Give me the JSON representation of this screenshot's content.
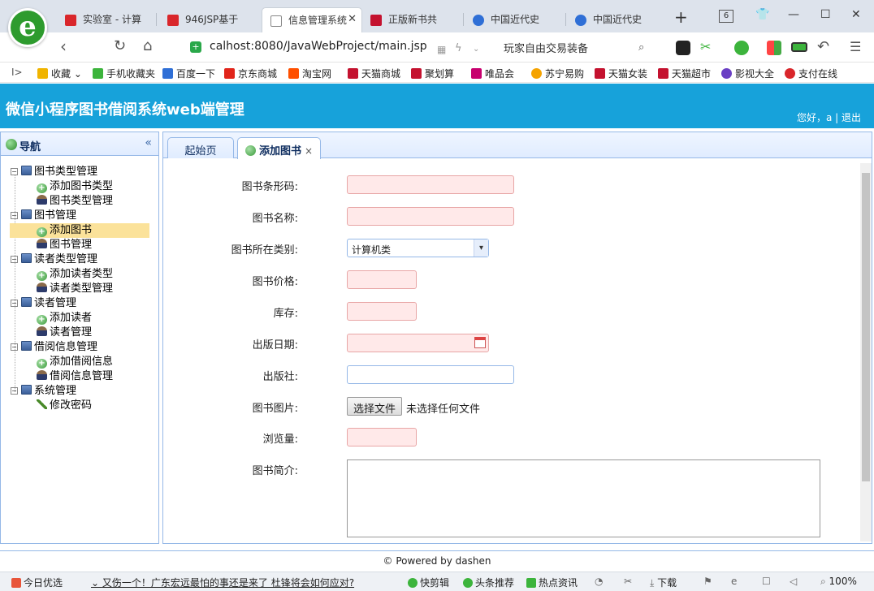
{
  "browser": {
    "tabs": [
      {
        "label": "实验室 - 计算",
        "favicon_color": "#d9262b"
      },
      {
        "label": "946JSP基于",
        "favicon_color": "#d9262b"
      },
      {
        "label": "信息管理系统",
        "favicon_color": "#ffffff",
        "active": true
      },
      {
        "label": "正版新书共",
        "favicon_color": "#c4122f"
      },
      {
        "label": "中国近代史",
        "favicon_color": "#2f6fd6"
      },
      {
        "label": "中国近代史",
        "favicon_color": "#2f6fd6"
      }
    ],
    "new_tab": "+",
    "tab_count": "6",
    "url": "calhost:8080/JavaWebProject/main.jsp",
    "search_text": "玩家自由交易装备",
    "bookmarks_toggle": "I>",
    "bookmarks": [
      {
        "label": "收藏",
        "color": "#f0b400"
      },
      {
        "label": "手机收藏夹",
        "color": "#3cb43c"
      },
      {
        "label": "百度一下",
        "color": "#2f6fd6"
      },
      {
        "label": "京东商城",
        "color": "#e1251b"
      },
      {
        "label": "淘宝网",
        "color": "#ff5000"
      },
      {
        "label": "天猫商城",
        "color": "#c4122f"
      },
      {
        "label": "聚划算",
        "color": "#c4122f"
      },
      {
        "label": "唯品会",
        "color": "#c7006e"
      },
      {
        "label": "苏宁易购",
        "color": "#f5a300"
      },
      {
        "label": "天猫女装",
        "color": "#c4122f"
      },
      {
        "label": "天猫超市",
        "color": "#c4122f"
      },
      {
        "label": "影视大全",
        "color": "#6a3fc4"
      },
      {
        "label": "支付在线",
        "color": "#d9262b"
      }
    ],
    "logo_letter": "e"
  },
  "app": {
    "title": "微信小程序图书借阅系统web端管理",
    "user_text": "您好，a | 退出",
    "accent_color": "#17a2da"
  },
  "sidebar": {
    "title": "导航",
    "collapse": "«",
    "groups": [
      {
        "label": "图书类型管理",
        "items": [
          {
            "label": "添加图书类型",
            "icon": "add-icon"
          },
          {
            "label": "图书类型管理",
            "icon": "user-icon"
          }
        ]
      },
      {
        "label": "图书管理",
        "items": [
          {
            "label": "添加图书",
            "icon": "add-icon",
            "selected": true
          },
          {
            "label": "图书管理",
            "icon": "user-icon"
          }
        ]
      },
      {
        "label": "读者类型管理",
        "items": [
          {
            "label": "添加读者类型",
            "icon": "add-icon"
          },
          {
            "label": "读者类型管理",
            "icon": "user-icon"
          }
        ]
      },
      {
        "label": "读者管理",
        "items": [
          {
            "label": "添加读者",
            "icon": "add-icon"
          },
          {
            "label": "读者管理",
            "icon": "user-icon"
          }
        ]
      },
      {
        "label": "借阅信息管理",
        "items": [
          {
            "label": "添加借阅信息",
            "icon": "add-icon"
          },
          {
            "label": "借阅信息管理",
            "icon": "user-icon"
          }
        ]
      },
      {
        "label": "系统管理",
        "items": [
          {
            "label": "修改密码",
            "icon": "pencil-icon"
          }
        ]
      }
    ]
  },
  "main": {
    "tabs": [
      {
        "label": "起始页"
      },
      {
        "label": "添加图书",
        "active": true,
        "close": "×"
      }
    ],
    "form": {
      "barcode_label": "图书条形码:",
      "name_label": "图书名称:",
      "category_label": "图书所在类别:",
      "category_value": "计算机类",
      "price_label": "图书价格:",
      "stock_label": "库存:",
      "publish_date_label": "出版日期:",
      "publisher_label": "出版社:",
      "image_label": "图书图片:",
      "file_button": "选择文件",
      "file_status": "未选择任何文件",
      "views_label": "浏览量:",
      "intro_label": "图书简介:"
    },
    "footer": "© Powered by dashen"
  },
  "statusbar": {
    "items": [
      "今日优选",
      "又伤一个！广东宏远最怕的事还是来了 杜锋将会如何应对?",
      "快剪辑",
      "头条推荐",
      "热点资讯",
      "下载",
      "100%"
    ]
  }
}
